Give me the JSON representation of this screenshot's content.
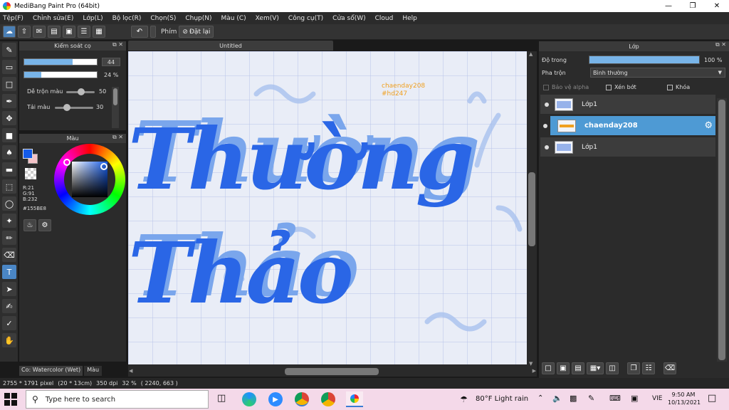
{
  "window": {
    "title": "MediBang Paint Pro (64bit)"
  },
  "menu": [
    "Tệp(F)",
    "Chỉnh sửa(E)",
    "Lớp(L)",
    "Bộ lọc(R)",
    "Chọn(S)",
    "Chụp(N)",
    "Màu (C)",
    "Xem(V)",
    "Công cụ(T)",
    "Cửa sổ(W)",
    "Cloud",
    "Help"
  ],
  "toolbar": {
    "key_label": "Phím",
    "reset_label": "Đặt lại"
  },
  "brush_panel": {
    "title": "Kiểm soát cọ",
    "size_value": "44",
    "size_fill": 0.67,
    "opacity_value": "24 %",
    "opacity_fill": 0.24,
    "blend_label": "Dễ trộn màu",
    "blend_value": "50",
    "charge_label": "Tải màu",
    "charge_value": "30",
    "tab_brush": "Co: Watercolor (Wet)",
    "tab_color": "Màu"
  },
  "color_panel": {
    "title": "Màu",
    "r": "R:21",
    "g": "G:91",
    "b": "B:232",
    "hex": "#155BE8",
    "fg_color": "#155BE8",
    "bg_color": "#f4c3c8"
  },
  "document": {
    "tab_title": "Untitled",
    "watermark_line1": "chaenday208",
    "watermark_line2": "#hd247",
    "lettering": "Thường Thảo"
  },
  "layer_panel": {
    "title": "Lớp",
    "opacity_label": "Độ trong",
    "opacity_value": "100 %",
    "blend_label": "Pha trộn",
    "blend_mode": "Bình thường",
    "protect_alpha": "Bảo vệ alpha",
    "clipping": "Xén bớt",
    "lock": "Khóa",
    "layers": [
      {
        "name": "Lớp1",
        "selected": false
      },
      {
        "name": "chaenday208",
        "selected": true
      },
      {
        "name": "Lớp1",
        "selected": false
      }
    ]
  },
  "status": {
    "size": "2755 * 1791 pixel",
    "cm": "(20 * 13cm)",
    "dpi": "350 dpi",
    "zoom": "32 %",
    "coords": "( 2240, 663 )"
  },
  "taskbar": {
    "search_placeholder": "Type here to search",
    "weather": "80°F  Light rain",
    "lang": "VIE",
    "time": "9:50 AM",
    "date": "10/13/2021"
  }
}
